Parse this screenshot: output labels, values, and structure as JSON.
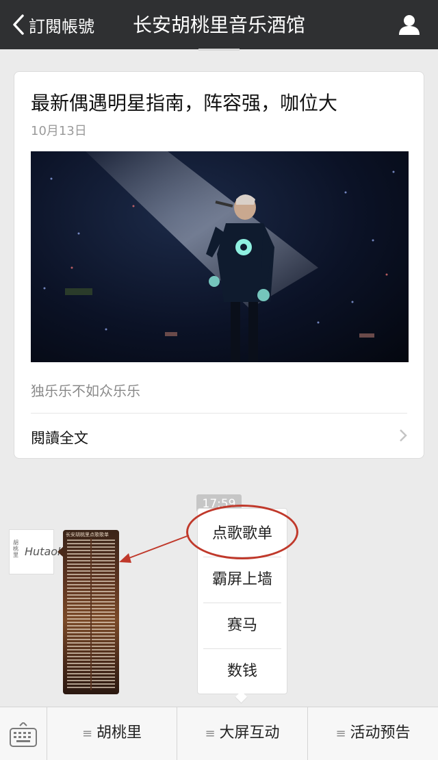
{
  "nav": {
    "back_label": "訂閱帳號",
    "title": "长安胡桃里音乐酒馆"
  },
  "article": {
    "title": "最新偶遇明星指南，阵容强，咖位大",
    "date": "10月13日",
    "digest": "独乐乐不如众乐乐",
    "read_all": "閱讀全文"
  },
  "chat": {
    "time": "17:59",
    "avatar_text": "Hutaoli",
    "avatar_cjk": "胡桃里",
    "song_list_header": "长安胡桃里点歌歌单"
  },
  "popup_menu": {
    "items": [
      {
        "label": "点歌歌单"
      },
      {
        "label": "霸屏上墙"
      },
      {
        "label": "赛马"
      },
      {
        "label": "数钱"
      }
    ]
  },
  "bottom_menu": {
    "items": [
      {
        "label": "胡桃里"
      },
      {
        "label": "大屏互动"
      },
      {
        "label": "活动预告"
      }
    ]
  },
  "colors": {
    "navbar": "#2f3032",
    "annotation": "#c0392b",
    "background": "#ebebeb"
  },
  "icons": [
    "back-chevron-icon",
    "user-icon",
    "chevron-right-icon",
    "keyboard-icon",
    "menu-hamburger-icon"
  ]
}
